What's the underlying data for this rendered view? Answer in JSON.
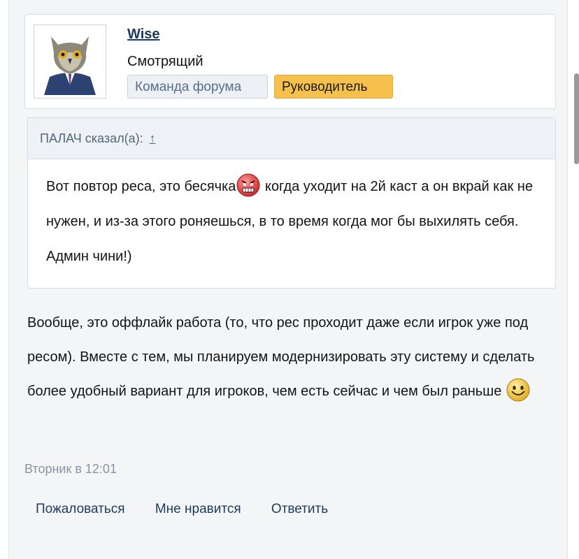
{
  "user": {
    "name": "Wise",
    "title": "Смотрящий",
    "badges": [
      "Команда форума",
      "Руководитель"
    ]
  },
  "quote": {
    "header": "ПАЛАЧ сказал(а):",
    "header_arrow": "↑",
    "text_before": "Вот повтор реса, это бесячка",
    "text_after": " когда уходит на 2й каст а он вкрай как не нужен, и из-за этого роняешься, в то время когда мог бы выхилять себя. Админ чини!)"
  },
  "post": {
    "text": "Вообще, это оффлайк работа (то, что рес проходит даже если игрок уже под ресом). Вместе с тем, мы планируем модернизировать эту систему и сделать более удобный вариант для игроков, чем есть сейчас и чем был раньше",
    "timestamp": "Вторник в 12:01"
  },
  "actions": [
    "Пожаловаться",
    "Мне нравится",
    "Ответить"
  ],
  "icons": {
    "quote_smiley": "angry-face-icon",
    "post_smiley": "happy-face-icon"
  },
  "colors": {
    "link": "#1b3a5c",
    "badge_lead": "#f5c04c",
    "badge_team": "#edf1f6"
  }
}
